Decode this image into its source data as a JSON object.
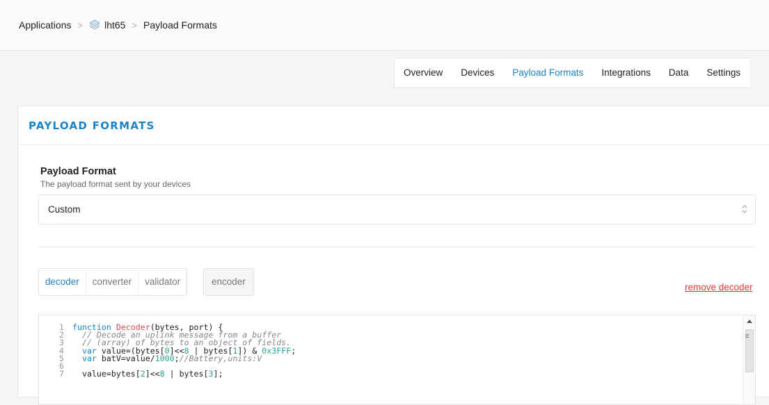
{
  "breadcrumb": {
    "items": [
      "Applications",
      "lht65",
      "Payload Formats"
    ],
    "separator": ">"
  },
  "tabs": [
    "Overview",
    "Devices",
    "Payload Formats",
    "Integrations",
    "Data",
    "Settings"
  ],
  "active_tab": "Payload Formats",
  "card": {
    "title": "PAYLOAD FORMATS",
    "field_label": "Payload Format",
    "field_desc": "The payload format sent by your devices",
    "select_value": "Custom"
  },
  "function_tabs": {
    "decoder": "decoder",
    "converter": "converter",
    "validator": "validator",
    "encoder": "encoder"
  },
  "remove_label": "remove decoder",
  "editor": {
    "line_numbers": [
      "1",
      "2",
      "3",
      "4",
      "5",
      "6",
      "7"
    ],
    "lines": [
      "function Decoder(bytes, port) {",
      "  // Decode an uplink message from a buffer",
      "  // (array) of bytes to an object of fields.",
      "  var value=(bytes[0]<<8 | bytes[1]) & 0x3FFF;",
      "  var batV=value/1000;//Battery,units:V",
      "",
      "  value=bytes[2]<<8 | bytes[3];"
    ]
  },
  "colors": {
    "accent": "#1c84c6",
    "danger": "#e53935"
  }
}
